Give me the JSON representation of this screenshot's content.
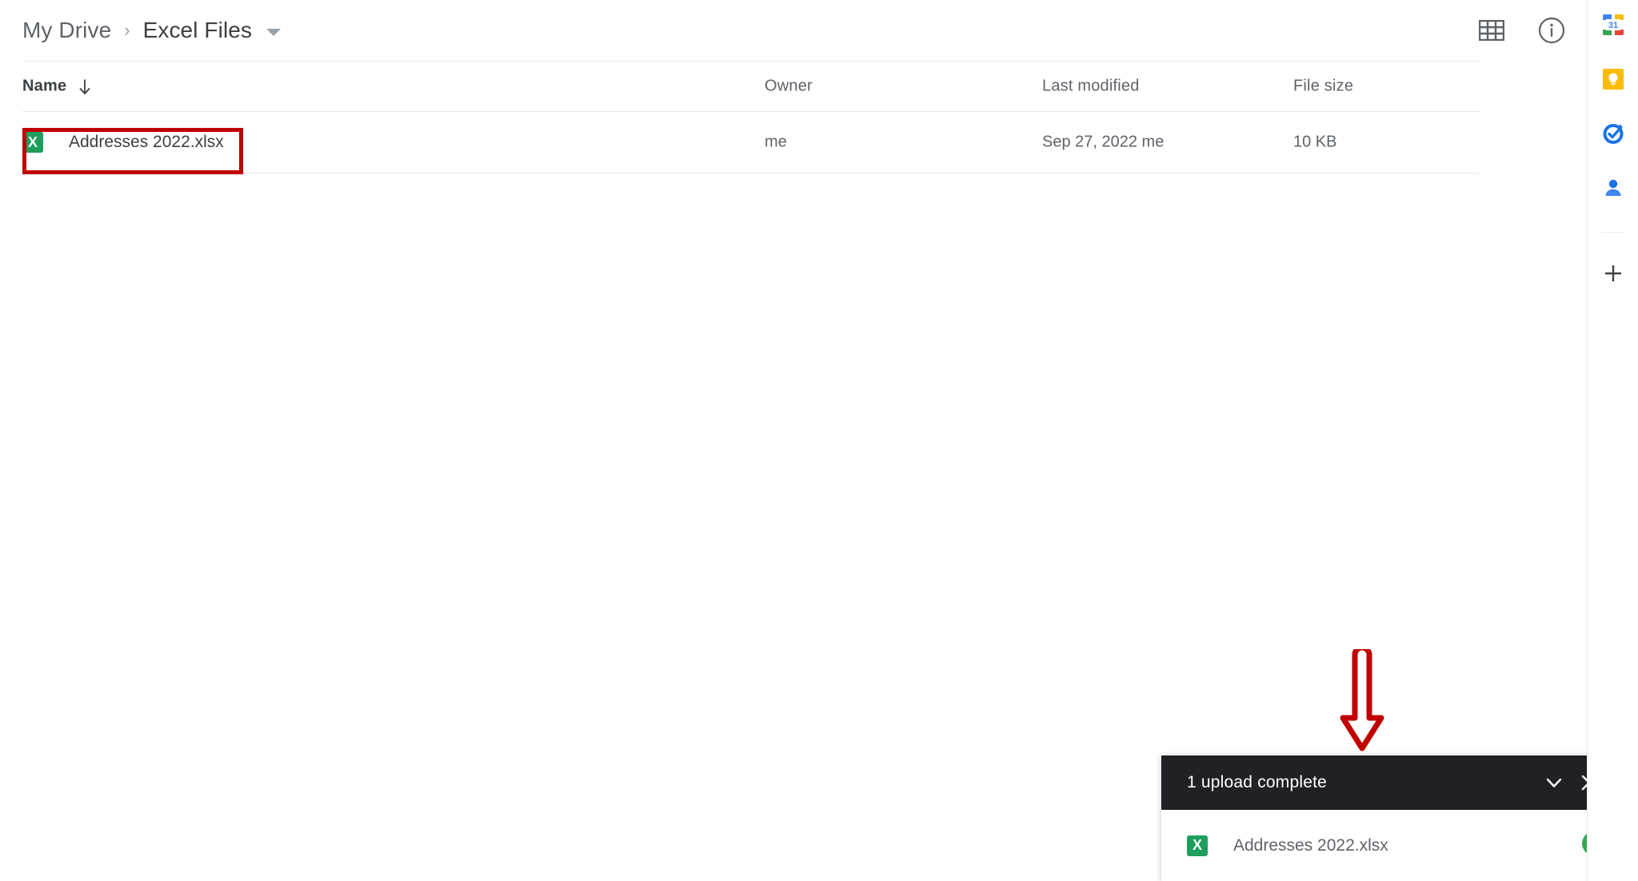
{
  "breadcrumb": {
    "parent": "My Drive",
    "separator": "›",
    "current": "Excel Files",
    "caret_icon": "chevron-down-icon"
  },
  "header_actions": [
    {
      "name": "grid-view-icon",
      "label": "Grid view"
    },
    {
      "name": "info-icon",
      "label": "View details"
    }
  ],
  "table": {
    "columns": [
      {
        "key": "name",
        "label": "Name",
        "sort_icon": "arrow-down-icon",
        "sorted": true
      },
      {
        "key": "owner",
        "label": "Owner"
      },
      {
        "key": "modified",
        "label": "Last modified"
      },
      {
        "key": "size",
        "label": "File size"
      }
    ],
    "rows": [
      {
        "icon": "excel-file-icon",
        "name": "Addresses 2022.xlsx",
        "owner": "me",
        "modified": "Sep 27, 2022 me",
        "size": "10 KB"
      }
    ]
  },
  "toast": {
    "title": "1 upload complete",
    "collapse_icon": "chevron-down-icon",
    "close_icon": "close-icon",
    "file": {
      "icon": "excel-file-icon",
      "name": "Addresses 2022.xlsx",
      "status_icon": "check-circle-icon"
    }
  },
  "sidebar": {
    "items": [
      {
        "name": "google-calendar-icon",
        "label": "Calendar",
        "badge": "31"
      },
      {
        "name": "google-keep-icon",
        "label": "Keep"
      },
      {
        "name": "google-tasks-icon",
        "label": "Tasks"
      },
      {
        "name": "google-contacts-icon",
        "label": "Contacts"
      }
    ],
    "add_label": "+",
    "add_icon": "plus-icon"
  },
  "annotations": {
    "box_color": "#c00000",
    "arrow_color": "#c00000"
  },
  "colors": {
    "excel_green": "#1e9e5c",
    "toast_header": "#202124",
    "success_green": "#34a853"
  }
}
